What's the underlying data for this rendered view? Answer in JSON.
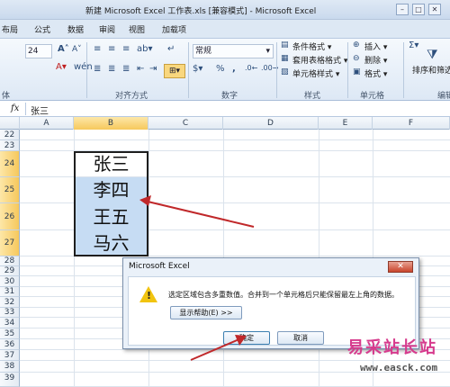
{
  "window": {
    "title": "新建 Microsoft Excel 工作表.xls  [兼容模式]  -  Microsoft Excel",
    "controls": [
      "–",
      "□",
      "✕"
    ]
  },
  "ribbon_tabs": [
    "布局",
    "公式",
    "数据",
    "审阅",
    "视图",
    "加载项"
  ],
  "ribbon": {
    "font_size": "24",
    "number_format": "常规",
    "groups": [
      "体",
      "对齐方式",
      "数字",
      "样式",
      "单元格",
      "编辑"
    ],
    "styles": [
      "条件格式 ▾",
      "套用表格格式 ▾",
      "单元格样式 ▾"
    ],
    "cells": [
      "插入 ▾",
      "删除 ▾",
      "格式 ▾"
    ],
    "edit": "排序和筛选",
    "percent": "%",
    "comma": ","
  },
  "formula_bar": {
    "fx": "fx",
    "value": "张三"
  },
  "columns": [
    "A",
    "B",
    "C",
    "D",
    "E",
    "F"
  ],
  "rows": [
    "22",
    "23",
    "24",
    "25",
    "26",
    "27",
    "28",
    "29",
    "30",
    "31",
    "32",
    "33",
    "34",
    "35",
    "36",
    "37",
    "38",
    "39"
  ],
  "cells": [
    "张三",
    "李四",
    "王五",
    "马六"
  ],
  "dialog": {
    "title": "Microsoft Excel",
    "message": "选定区域包含多重数值。合并到一个单元格后只能保留最左上角的数据。",
    "help_button": "显示帮助(E) >>",
    "ok_button": "确定",
    "cancel_button": "取消"
  },
  "watermark": {
    "title": "易采站长站",
    "url": "www.easck.com"
  }
}
